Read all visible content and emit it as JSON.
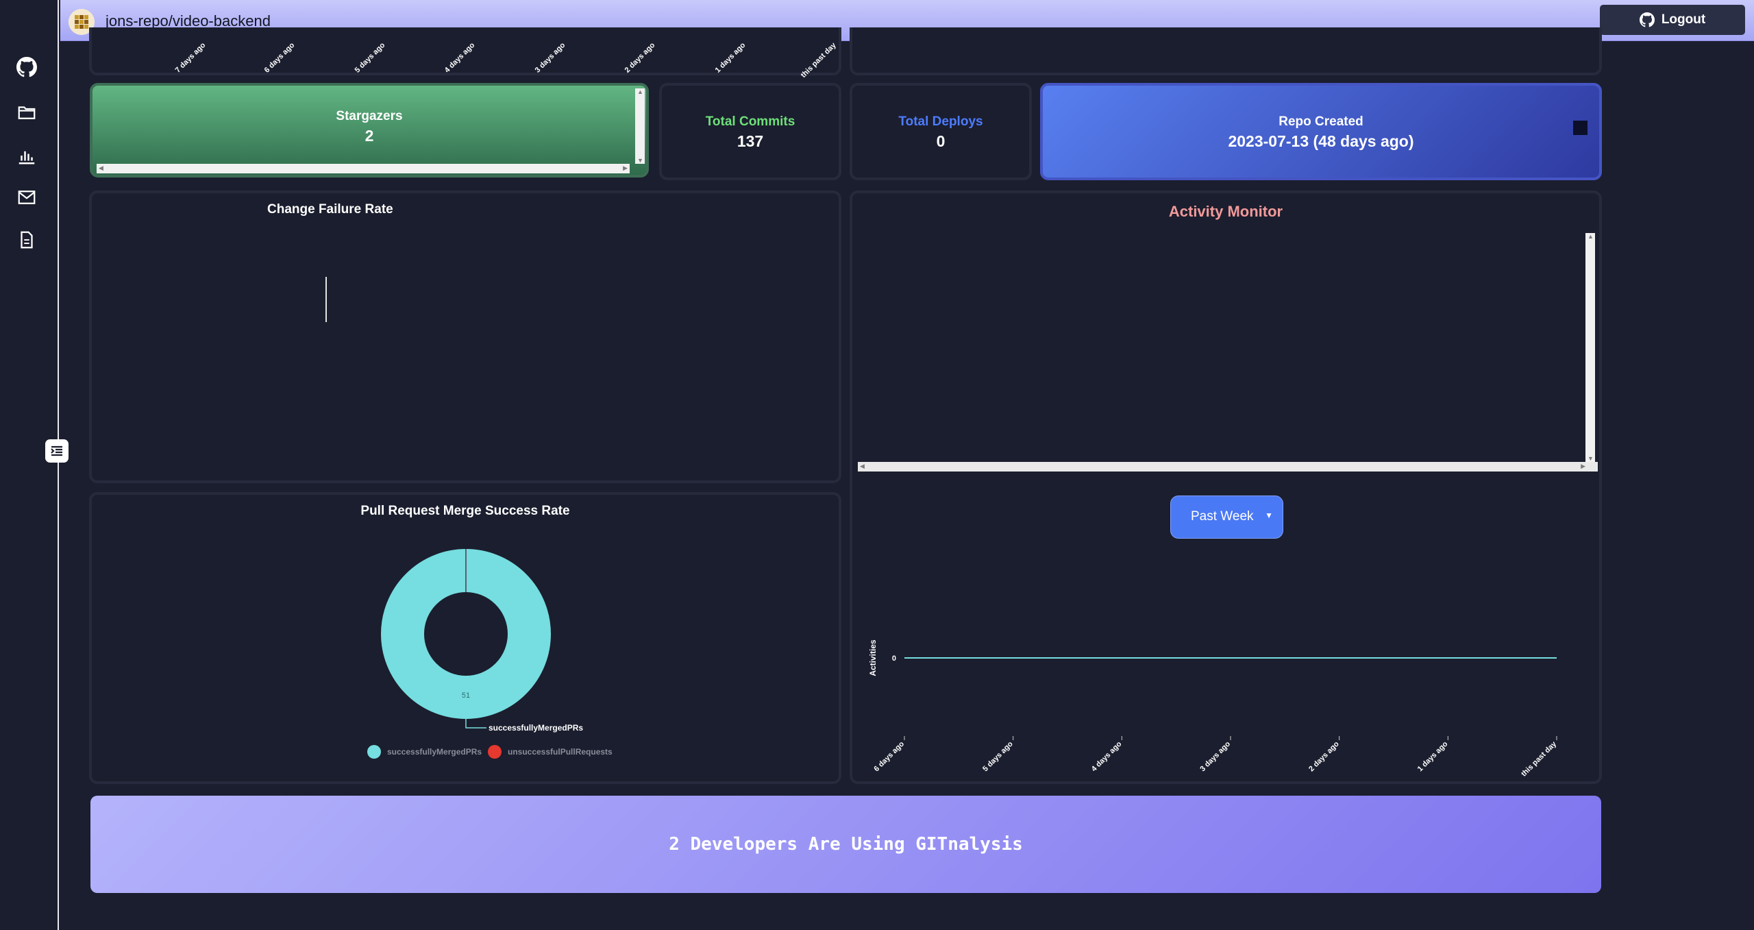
{
  "header": {
    "repo_title": "jons-repo/video-backend",
    "logout_label": "Logout"
  },
  "sidebar": {
    "items": [
      {
        "icon": "github-icon"
      },
      {
        "icon": "folder-icon"
      },
      {
        "icon": "bar-chart-icon"
      },
      {
        "icon": "mail-icon"
      },
      {
        "icon": "document-icon"
      }
    ]
  },
  "top_chart": {
    "x_ticks": [
      "7 days ago",
      "6 days ago",
      "5 days ago",
      "4 days ago",
      "3 days ago",
      "2 days ago",
      "1 days ago",
      "this past day"
    ]
  },
  "stats": {
    "stargazers": {
      "label": "Stargazers",
      "value": "2"
    },
    "commits": {
      "label": "Total Commits",
      "value": "137"
    },
    "deploys": {
      "label": "Total Deploys",
      "value": "0"
    },
    "repo_created": {
      "label": "Repo Created",
      "value": "2023-07-13 (48 days ago)"
    }
  },
  "change_failure": {
    "title": "Change Failure Rate"
  },
  "activity_monitor": {
    "title": "Activity Monitor"
  },
  "activity_chart": {
    "dropdown_label": "Past Week",
    "ylabel": "Activities",
    "y_tick": "0",
    "x_ticks": [
      "6 days ago",
      "5 days ago",
      "4 days ago",
      "3 days ago",
      "2 days ago",
      "1 days ago",
      "this past day"
    ]
  },
  "pr_chart": {
    "title": "Pull Request Merge Success Rate",
    "slice_label": "51",
    "callout_label": "successfullyMergedPRs",
    "legend": [
      "successfullyMergedPRs",
      "unsuccessfulPullRequests"
    ]
  },
  "footer": {
    "text": "2 Developers Are Using GITnalysis"
  },
  "colors": {
    "merged": "#76dde0",
    "unsuccessful": "#e5382f",
    "commits": "#6ee07a",
    "deploys": "#4d7cff",
    "activity_title": "#f29a9a"
  },
  "chart_data": [
    {
      "type": "pie",
      "title": "Pull Request Merge Success Rate",
      "labels": [
        "successfullyMergedPRs",
        "unsuccessfulPullRequests"
      ],
      "values": [
        51,
        0
      ]
    },
    {
      "type": "line",
      "title": "",
      "ylabel": "Activities",
      "categories": [
        "6 days ago",
        "5 days ago",
        "4 days ago",
        "3 days ago",
        "2 days ago",
        "1 days ago",
        "this past day"
      ],
      "values": [
        0,
        0,
        0,
        0,
        0,
        0,
        0
      ]
    }
  ]
}
